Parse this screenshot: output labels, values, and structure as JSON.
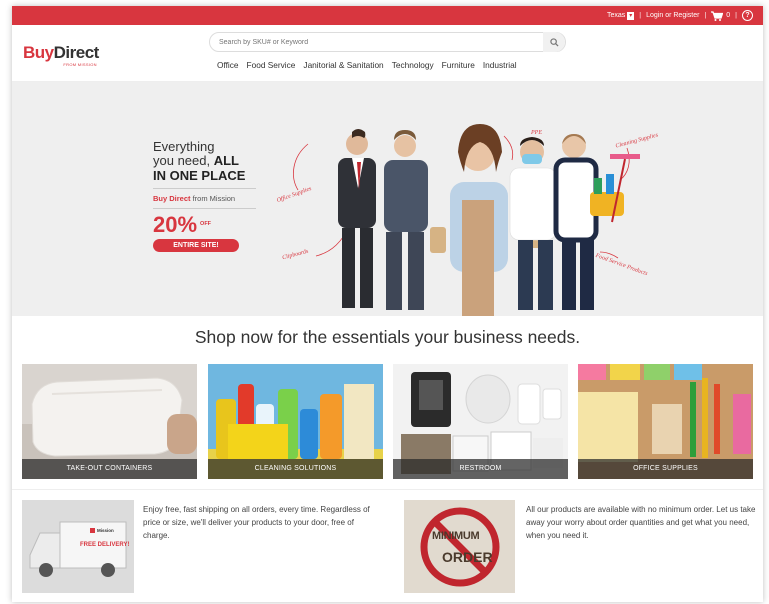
{
  "topbar": {
    "state": "Texas",
    "login_label": "Login or Register",
    "cart_count": "0",
    "sep": "|",
    "help_glyph": "?"
  },
  "header": {
    "logo_buy": "Buy",
    "logo_direct": "Direct",
    "logo_sub": "FROM MISSION",
    "search_placeholder": "Search by SKU# or Keyword"
  },
  "nav": [
    "Office",
    "Food Service",
    "Janitorial & Sanitation",
    "Technology",
    "Furniture",
    "Industrial"
  ],
  "hero": {
    "line1": "Everything",
    "line2_a": "you need, ",
    "line2_b": "ALL",
    "line3": "IN ONE PLACE",
    "brand_a": "Buy Direct",
    "brand_b": " from Mission",
    "percent": "20%",
    "off": "OFF",
    "badge": "ENTIRE SITE!",
    "annotations": {
      "ppe": "PPE",
      "cleaning": "Cleaning Supplies",
      "office": "Office Supplies",
      "clipboards": "Clipboards",
      "food": "Food Service Products"
    }
  },
  "headline": "Shop now for the essentials your business needs.",
  "categories": [
    {
      "label": "TAKE-OUT CONTAINERS"
    },
    {
      "label": "CLEANING SOLUTIONS"
    },
    {
      "label": "RESTROOM"
    },
    {
      "label": "OFFICE SUPPLIES"
    }
  ],
  "info": {
    "shipping_text": "Enjoy free, fast shipping on all orders, every time. Regardless of price or size, we'll deliver your products to your door, free of charge.",
    "truck_label": "FREE DELIVERY!",
    "truck_brand": "Mission",
    "minimum_text": "All our products are available with no minimum order. Let us take away your worry about order quantities and get what you need, when you need it.",
    "min_line1": "MINIMUM",
    "min_line2": "ORDER"
  },
  "colors": {
    "brand_red": "#d8363f"
  }
}
